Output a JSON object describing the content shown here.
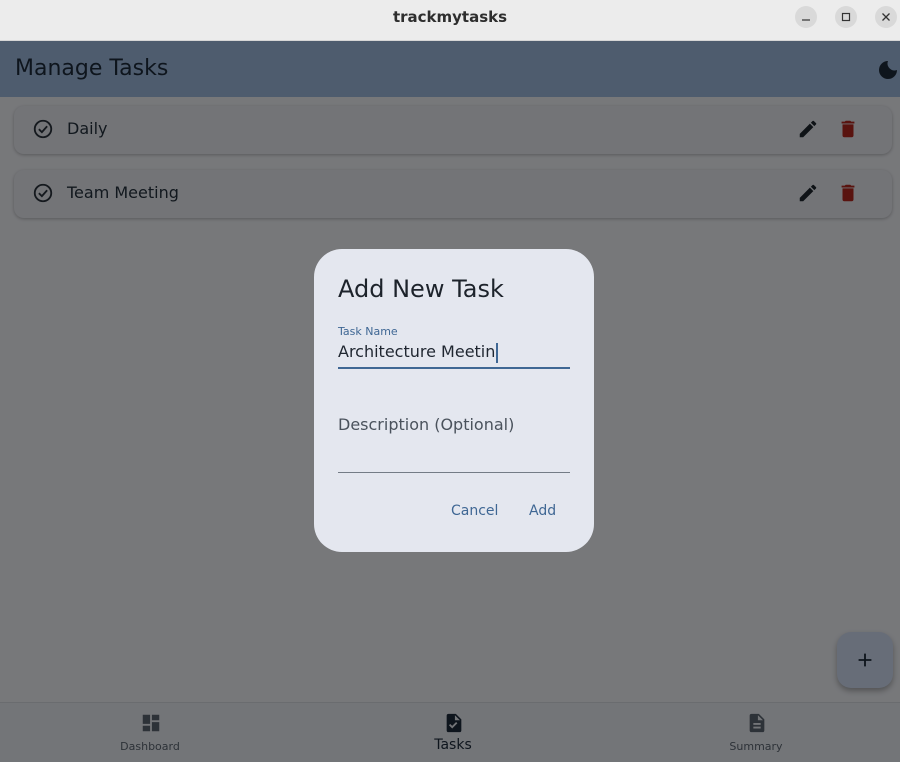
{
  "window": {
    "title": "trackmytasks"
  },
  "appbar": {
    "title": "Manage Tasks"
  },
  "tasks": [
    {
      "name": "Daily"
    },
    {
      "name": "Team Meeting"
    }
  ],
  "dialog": {
    "title": "Add New Task",
    "task_name_label": "Task Name",
    "task_name_value": "Architecture Meetin",
    "description_placeholder": "Description (Optional)",
    "cancel_label": "Cancel",
    "add_label": "Add"
  },
  "bottom_nav": {
    "items": [
      {
        "label": "Dashboard",
        "icon": "dashboard-icon"
      },
      {
        "label": "Tasks",
        "icon": "task-icon",
        "active": true
      },
      {
        "label": "Summary",
        "icon": "summary-icon"
      }
    ]
  },
  "colors": {
    "appbar": "#9cb8dc",
    "accent": "#3f6794",
    "delete": "#b3261e"
  }
}
